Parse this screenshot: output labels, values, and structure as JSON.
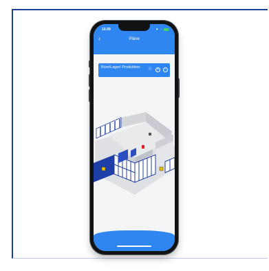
{
  "status_bar": {
    "time": "16:09",
    "icons": "▾ ◦"
  },
  "header": {
    "title": "Pläne",
    "back_icon": "chevron-left-icon"
  },
  "plan_card": {
    "label": "Büro/Lager/ Produktion",
    "icons": [
      "star-icon",
      "plus-circle-icon",
      "minus-circle-icon"
    ]
  },
  "colors": {
    "accent": "#2f86f0",
    "frame_border": "#1b3f97",
    "wall_blue": "#1f3fa8",
    "floor": "#e4e5e8"
  }
}
